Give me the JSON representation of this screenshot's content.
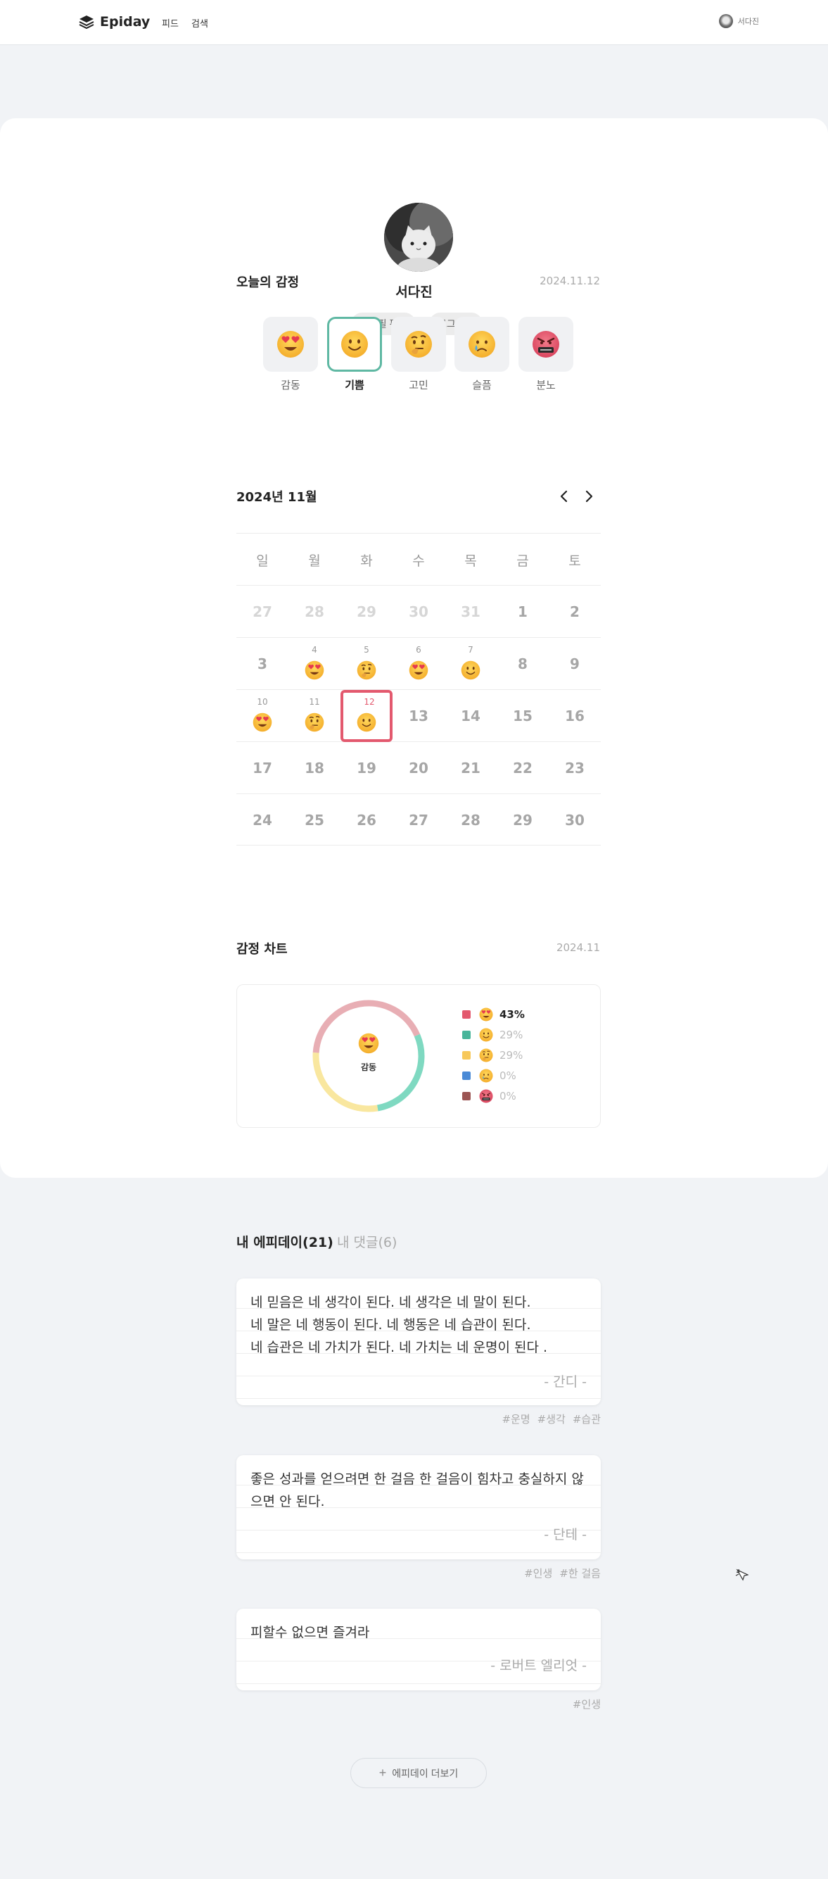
{
  "header": {
    "brand": "Epiday",
    "nav": [
      "피드",
      "검색"
    ],
    "user_name": "서다진"
  },
  "profile": {
    "name": "서다진",
    "edit_label": "프로필 편집",
    "logout_label": "로그아웃"
  },
  "today_emotion": {
    "title": "오늘의 감정",
    "date": "2024.11.12",
    "options": [
      {
        "label": "감동",
        "icon": "heart-eyes-face-icon"
      },
      {
        "label": "기쁨",
        "icon": "smiling-face-icon",
        "selected": true
      },
      {
        "label": "고민",
        "icon": "thinking-face-icon"
      },
      {
        "label": "슬픔",
        "icon": "crying-face-icon"
      },
      {
        "label": "분노",
        "icon": "angry-face-icon"
      }
    ]
  },
  "calendar": {
    "title": "2024년 11월",
    "weekdays": [
      "일",
      "월",
      "화",
      "수",
      "목",
      "금",
      "토"
    ],
    "weeks": [
      [
        {
          "d": "27",
          "prev": true
        },
        {
          "d": "28",
          "prev": true
        },
        {
          "d": "29",
          "prev": true
        },
        {
          "d": "30",
          "prev": true
        },
        {
          "d": "31",
          "prev": true
        },
        {
          "d": "1"
        },
        {
          "d": "2"
        }
      ],
      [
        {
          "d": "3"
        },
        {
          "d": "4",
          "emo": "love"
        },
        {
          "d": "5",
          "emo": "think"
        },
        {
          "d": "6",
          "emo": "love"
        },
        {
          "d": "7",
          "emo": "happy"
        },
        {
          "d": "8"
        },
        {
          "d": "9"
        }
      ],
      [
        {
          "d": "10",
          "emo": "love"
        },
        {
          "d": "11",
          "emo": "think"
        },
        {
          "d": "12",
          "emo": "happy",
          "today": true
        },
        {
          "d": "13"
        },
        {
          "d": "14"
        },
        {
          "d": "15"
        },
        {
          "d": "16"
        }
      ],
      [
        {
          "d": "17"
        },
        {
          "d": "18"
        },
        {
          "d": "19"
        },
        {
          "d": "20"
        },
        {
          "d": "21"
        },
        {
          "d": "22"
        },
        {
          "d": "23"
        }
      ],
      [
        {
          "d": "24"
        },
        {
          "d": "25"
        },
        {
          "d": "26"
        },
        {
          "d": "27"
        },
        {
          "d": "28"
        },
        {
          "d": "29"
        },
        {
          "d": "30"
        }
      ]
    ]
  },
  "emotion_chart": {
    "title": "감정 차트",
    "period": "2024.11",
    "center_label": "감동",
    "legend": [
      {
        "icon": "heart-eyes-face-icon",
        "pct": "43%",
        "color": "#e3596e"
      },
      {
        "icon": "smiling-face-icon",
        "pct": "29%",
        "color": "#48b59a"
      },
      {
        "icon": "thinking-face-icon",
        "pct": "29%",
        "color": "#f7c85a"
      },
      {
        "icon": "crying-face-icon",
        "pct": "0%",
        "color": "#4a8ad6"
      },
      {
        "icon": "angry-face-icon",
        "pct": "0%",
        "color": "#9b5553"
      }
    ]
  },
  "chart_data": {
    "type": "pie",
    "categories": [
      "감동",
      "기쁨",
      "고민",
      "슬픔",
      "분노"
    ],
    "values": [
      43,
      29,
      29,
      0,
      0
    ],
    "colors": [
      "#e8aeb4",
      "#7fd9c1",
      "#f9e79f",
      "#4a8ad6",
      "#9b5553"
    ]
  },
  "tabs": {
    "my_epidays": "내 에피데이(21)",
    "my_comments": "내 댓글(6)"
  },
  "posts": [
    {
      "lines": [
        "네 믿음은 네 생각이 된다. 네 생각은 네 말이 된다.",
        "네 말은 네 행동이 된다. 네 행동은 네 습관이 된다.",
        "네 습관은 네 가치가 된다. 네 가치는 네 운명이 된다 ."
      ],
      "author": "- 간디 -",
      "tags": [
        "#운명",
        "#생각",
        "#습관"
      ]
    },
    {
      "lines": [
        "좋은 성과를 얻으려면 한 걸음 한 걸음이 힘차고 충실하지 않",
        "으면 안 된다."
      ],
      "author": "- 단테 -",
      "tags": [
        "#인생",
        "#한 걸음"
      ]
    },
    {
      "lines": [
        "피할수 없으면 즐겨라"
      ],
      "author": "- 로버트 엘리엇 -",
      "tags": [
        "#인생"
      ]
    }
  ],
  "more_label": "에피데이 더보기"
}
